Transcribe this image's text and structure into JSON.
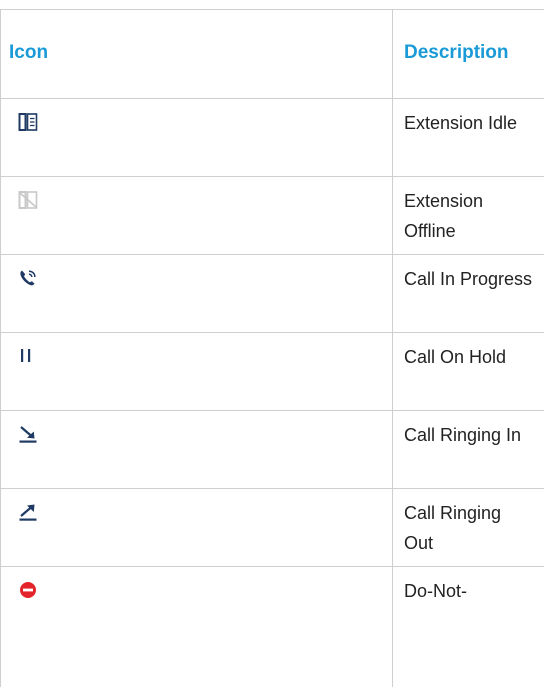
{
  "table": {
    "headers": {
      "icon": "Icon",
      "description": "Description"
    },
    "rows": [
      {
        "icon": "extension-idle-icon",
        "description": "Extension Idle"
      },
      {
        "icon": "extension-offline-icon",
        "description": "Extension Offline"
      },
      {
        "icon": "call-in-progress-icon",
        "description": "Call In Progress"
      },
      {
        "icon": "call-on-hold-icon",
        "description": "Call On Hold"
      },
      {
        "icon": "call-ringing-in-icon",
        "description": "Call Ringing In"
      },
      {
        "icon": "call-ringing-out-icon",
        "description": "Call Ringing Out"
      },
      {
        "icon": "do-not-disturb-icon",
        "description": "Do-Not-"
      }
    ]
  },
  "colors": {
    "header_text": "#1a9ad6",
    "icon_navy": "#1f3a63",
    "icon_offline": "#c8c8c8",
    "dnd_red": "#e3242b",
    "border": "#cfcfcf"
  }
}
